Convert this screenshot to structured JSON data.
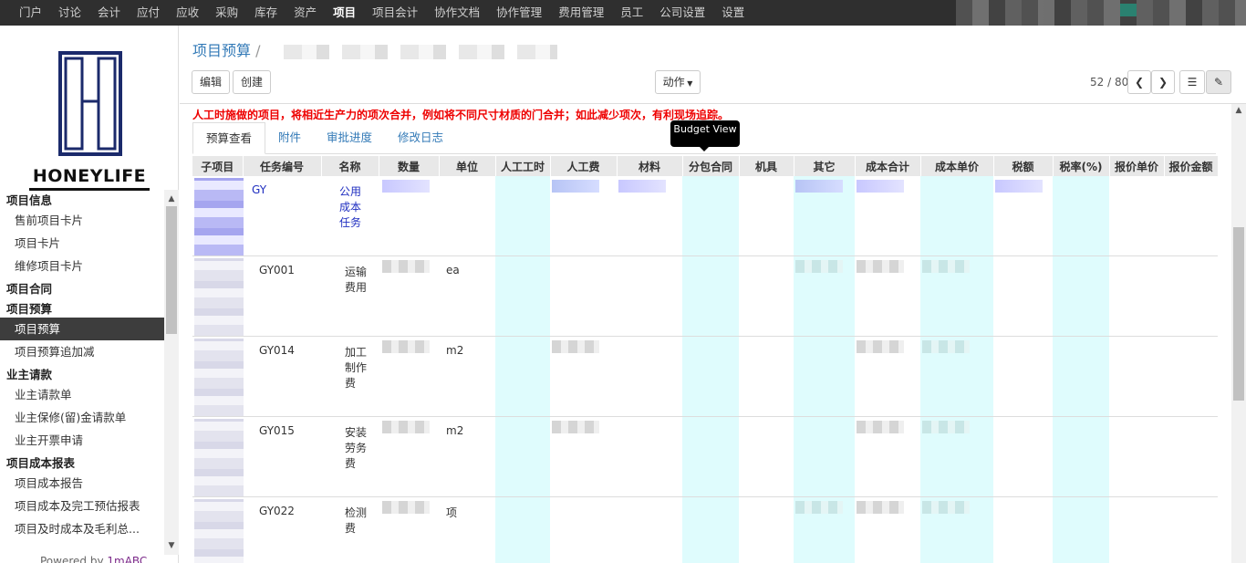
{
  "topnav": [
    "门户",
    "讨论",
    "会计",
    "应付",
    "应收",
    "采购",
    "库存",
    "资产",
    "项目",
    "项目会计",
    "协作文档",
    "协作管理",
    "费用管理",
    "员工",
    "公司设置",
    "设置"
  ],
  "topnav_active": "项目",
  "logo": {
    "text": "HONEYLIFE"
  },
  "sidebar": {
    "groups": [
      {
        "head": "项目信息",
        "items": [
          "售前项目卡片",
          "项目卡片",
          "维修项目卡片"
        ]
      },
      {
        "head": "项目合同",
        "items": []
      },
      {
        "head": "项目预算",
        "items": [
          "项目预算",
          "项目预算追加减"
        ]
      },
      {
        "head": "业主请款",
        "items": [
          "业主请款单",
          "业主保修(留)金请款单",
          "业主开票申请"
        ]
      },
      {
        "head": "项目成本报表",
        "items": [
          "项目成本报告",
          "项目成本及完工预估报表",
          "项目及时成本及毛利总..."
        ]
      }
    ],
    "active": "项目预算",
    "powered_prefix": "Powered by ",
    "powered_brand": "1mABC"
  },
  "breadcrumb": {
    "root": "项目预算",
    "sep": "/"
  },
  "toolbar": {
    "edit": "编辑",
    "create": "创建",
    "action": "动作"
  },
  "pager": {
    "text": "52 / 80"
  },
  "warning": "人工时施做的项目，将相近生产力的项次合并，例如将不同尺寸材质的门合并；如此减少项次，有利现场追踪。",
  "tabs": [
    "预算查看",
    "附件",
    "审批进度",
    "修改日志"
  ],
  "tooltip": "Budget View",
  "table": {
    "columns": [
      "子项目",
      "任务编号",
      "名称",
      "数量",
      "单位",
      "人工工时",
      "人工费",
      "材料",
      "分包合同",
      "机具",
      "其它",
      "成本合计",
      "成本单价",
      "税额",
      "税率(%)",
      "报价单价",
      "报价金额"
    ],
    "rows": [
      {
        "code": "GY",
        "name": "公用成本任务",
        "unit": ""
      },
      {
        "code": "GY001",
        "name": "运输费用",
        "unit": "ea"
      },
      {
        "code": "GY014",
        "name": "加工制作费",
        "unit": "m2"
      },
      {
        "code": "GY015",
        "name": "安装劳务费",
        "unit": "m2"
      },
      {
        "code": "GY022",
        "name": "检测费",
        "unit": "项"
      }
    ]
  },
  "colors": {
    "topbar": "#2f2f2f",
    "link": "#337ab7",
    "warning": "#ee0000",
    "cyan_col": "#dffcfd"
  }
}
